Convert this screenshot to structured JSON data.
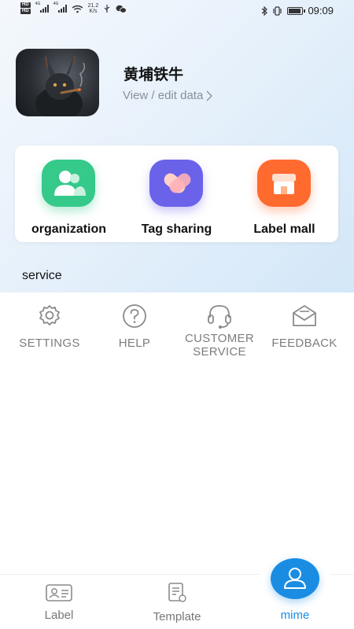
{
  "status_bar": {
    "network_badges": [
      "HD",
      "HD"
    ],
    "signal_labels": [
      "4G",
      "4G"
    ],
    "net_speed_value": "21.2",
    "net_speed_unit": "K/s",
    "time": "09:09",
    "icons": [
      "signal-icon",
      "wifi-icon",
      "usb-icon",
      "wechat-icon",
      "bluetooth-icon",
      "vibrate-icon",
      "battery-icon"
    ]
  },
  "profile": {
    "name": "黄埔铁牛",
    "edit_link": "View / edit data"
  },
  "quick_actions": [
    {
      "label": "organization",
      "icon": "people-icon",
      "color": "#35c98a"
    },
    {
      "label": "Tag sharing",
      "icon": "heart-tag-icon",
      "color": "#6a62e8"
    },
    {
      "label": "Label mall",
      "icon": "store-icon",
      "color": "#ff6a2e"
    }
  ],
  "service_section": {
    "title": "service",
    "items": [
      {
        "label": "SETTINGS",
        "icon": "gear-icon"
      },
      {
        "label": "HELP",
        "icon": "question-icon"
      },
      {
        "label_line1": "CUSTOMER",
        "label_line2": "SERVICE",
        "icon": "headset-icon"
      },
      {
        "label": "FEEDBACK",
        "icon": "envelope-icon"
      }
    ]
  },
  "bottom_nav": {
    "items": [
      {
        "label": "Label",
        "icon": "id-card-icon"
      },
      {
        "label": "Template",
        "icon": "template-icon"
      },
      {
        "label": "mime",
        "icon": "user-icon",
        "active": true
      }
    ],
    "active_color": "#1a8de3",
    "inactive_color": "#777777"
  }
}
